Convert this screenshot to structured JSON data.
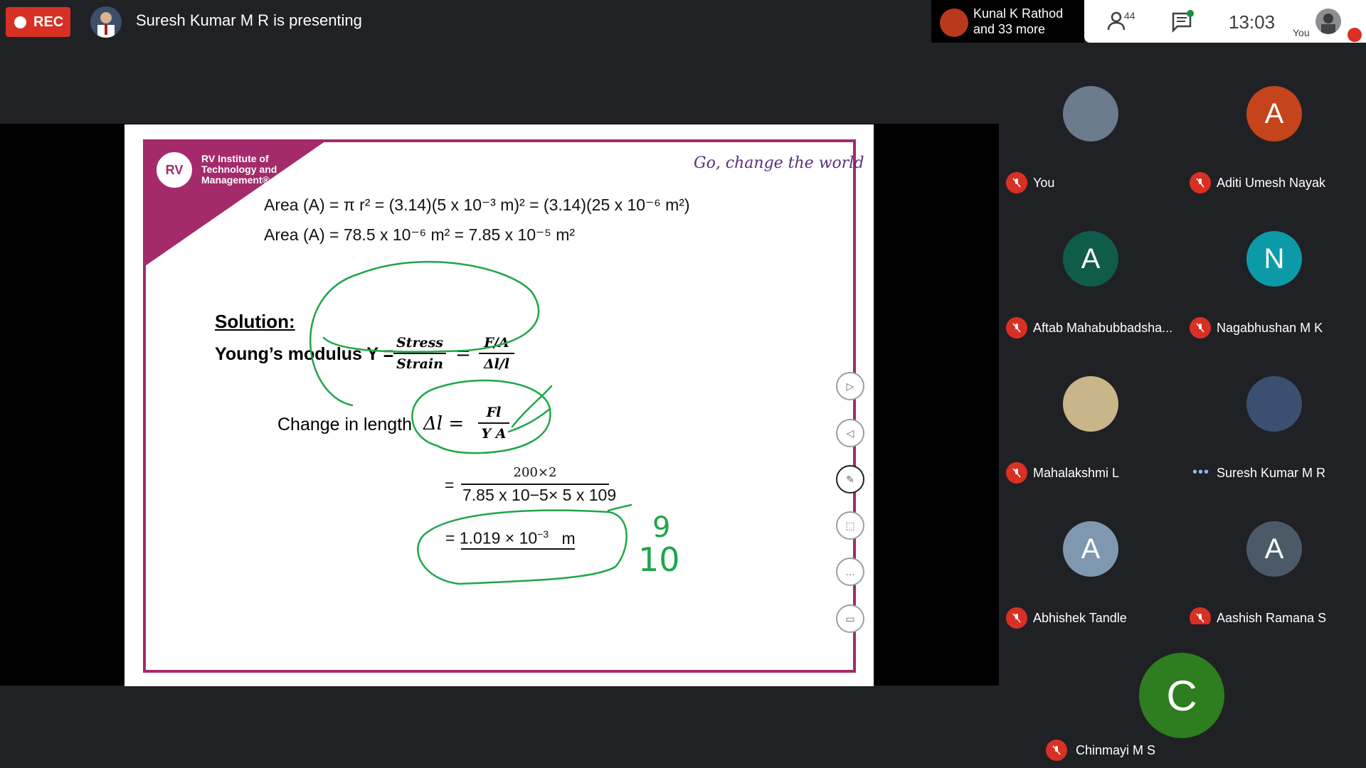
{
  "topbar": {
    "rec_label": "REC",
    "presenting_text": "Suresh Kumar M R is presenting",
    "others_line1": "Kunal K Rathod",
    "others_line2": "and 33 more",
    "people_count": "44",
    "clock": "13:03",
    "self_label": "You"
  },
  "slide": {
    "institute": "RV Institute of Technology and Management®",
    "logo_text": "RV",
    "tagline": "Go, change the world",
    "area_line1": "Area (A) = π r² = (3.14)(5 x 10⁻³ m)² = (3.14)(25 x 10⁻⁶ m²)",
    "area_line2": "Area (A) = 78.5 x 10⁻⁶ m² = 7.85 x 10⁻⁵ m²",
    "solution": "Solution:",
    "young": "Young’s modulus Y =",
    "stress": "Stress",
    "strain": "Strain",
    "fa_num": "F/A",
    "fa_den": "Δl/l",
    "change": "Change in length",
    "delta_l": "Δl  =",
    "fl_num": "Fl",
    "fl_den": "Y A",
    "calc_num": "200×2",
    "calc_den": "7.85 x 10−5× 5 x 109",
    "result": "= 1.019 ×  10",
    "result_exp": "−3",
    "result_unit": "m",
    "ink_9": "9",
    "ink_10": "10"
  },
  "participants": [
    {
      "name": "You",
      "initial": "",
      "color": "#6b7a8c",
      "muted": true
    },
    {
      "name": "Aditi Umesh Nayak",
      "initial": "A",
      "color": "#c5441b",
      "muted": true
    },
    {
      "name": "Aftab Mahabubbadsha...",
      "initial": "A",
      "color": "#0f5c4a",
      "muted": true
    },
    {
      "name": "Nagabhushan M K",
      "initial": "N",
      "color": "#0d9aa8",
      "muted": true
    },
    {
      "name": "Mahalakshmi L",
      "initial": "",
      "color": "#c9b58a",
      "muted": true
    },
    {
      "name": "Suresh Kumar M R",
      "initial": "",
      "color": "#3b4f70",
      "muted": false
    },
    {
      "name": "Abhishek Tandle",
      "initial": "A",
      "color": "#7f98b0",
      "muted": true
    },
    {
      "name": "Aashish Ramana S",
      "initial": "A",
      "color": "#4b5a66",
      "muted": true
    }
  ],
  "big_participant": {
    "name": "Chinmayi M S",
    "initial": "C",
    "color": "#2e7d1e",
    "muted": true
  }
}
